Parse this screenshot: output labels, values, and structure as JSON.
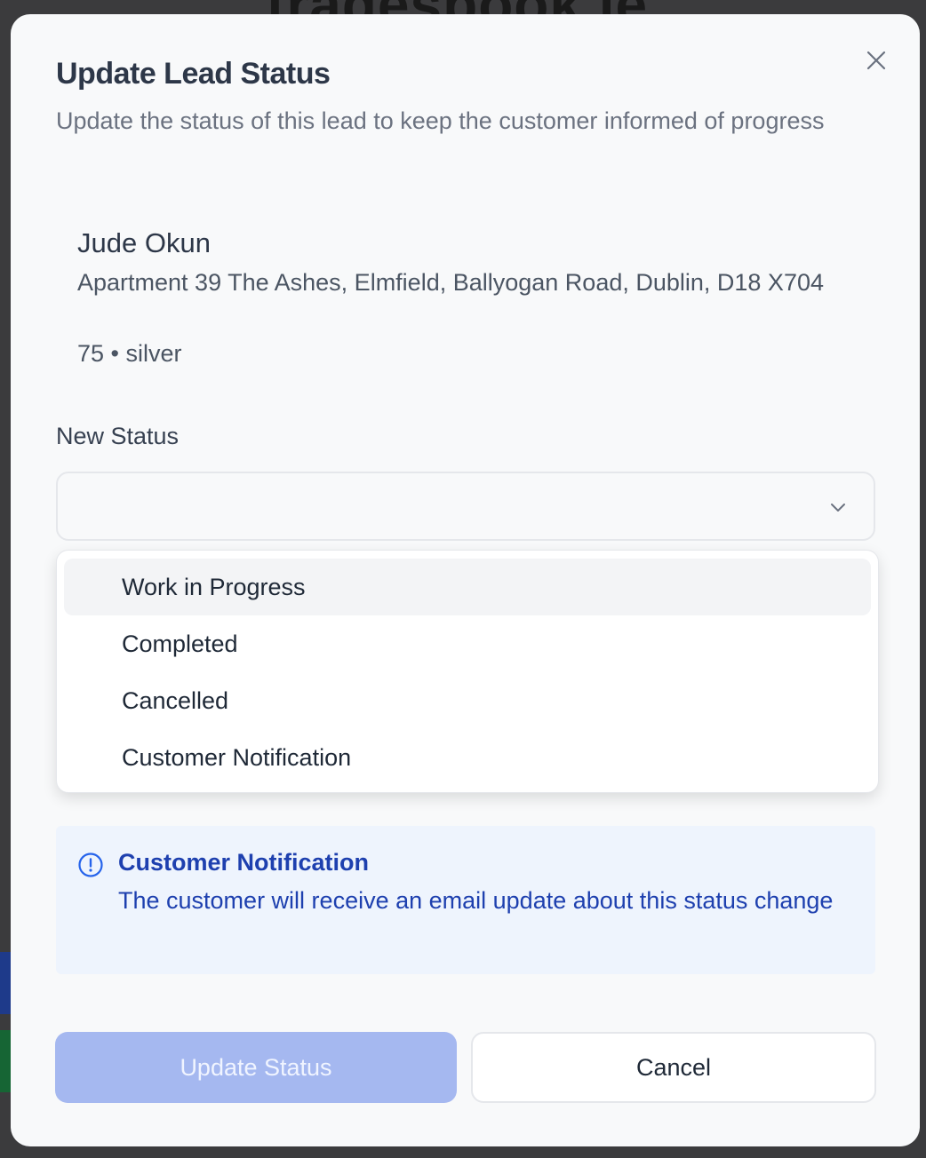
{
  "background": {
    "title": "tradesbook.ie"
  },
  "modal": {
    "title": "Update Lead Status",
    "subtitle": "Update the status of this lead to keep the customer informed of progress",
    "close_icon": "close-icon"
  },
  "lead": {
    "name": "Jude Okun",
    "address": "Apartment 39 The Ashes, Elmfield, Ballyogan Road, Dublin, D18 X704",
    "meta": "75 • silver"
  },
  "status_field": {
    "label": "New Status",
    "selected_value": "",
    "chevron_icon": "chevron-down-icon",
    "options": [
      {
        "label": "Work in Progress",
        "highlighted": true
      },
      {
        "label": "Completed",
        "highlighted": false
      },
      {
        "label": "Cancelled",
        "highlighted": false
      },
      {
        "label": "Customer Notification",
        "highlighted": false
      }
    ]
  },
  "notice": {
    "icon": "info-circle-icon",
    "title": "Customer Notification",
    "text": "The customer will receive an email update about this status change"
  },
  "actions": {
    "primary_label": "Update Status",
    "secondary_label": "Cancel"
  },
  "colors": {
    "primary_disabled": "#a5b8f0",
    "notice_bg": "#eef4fd",
    "notice_text": "#1e40af"
  }
}
